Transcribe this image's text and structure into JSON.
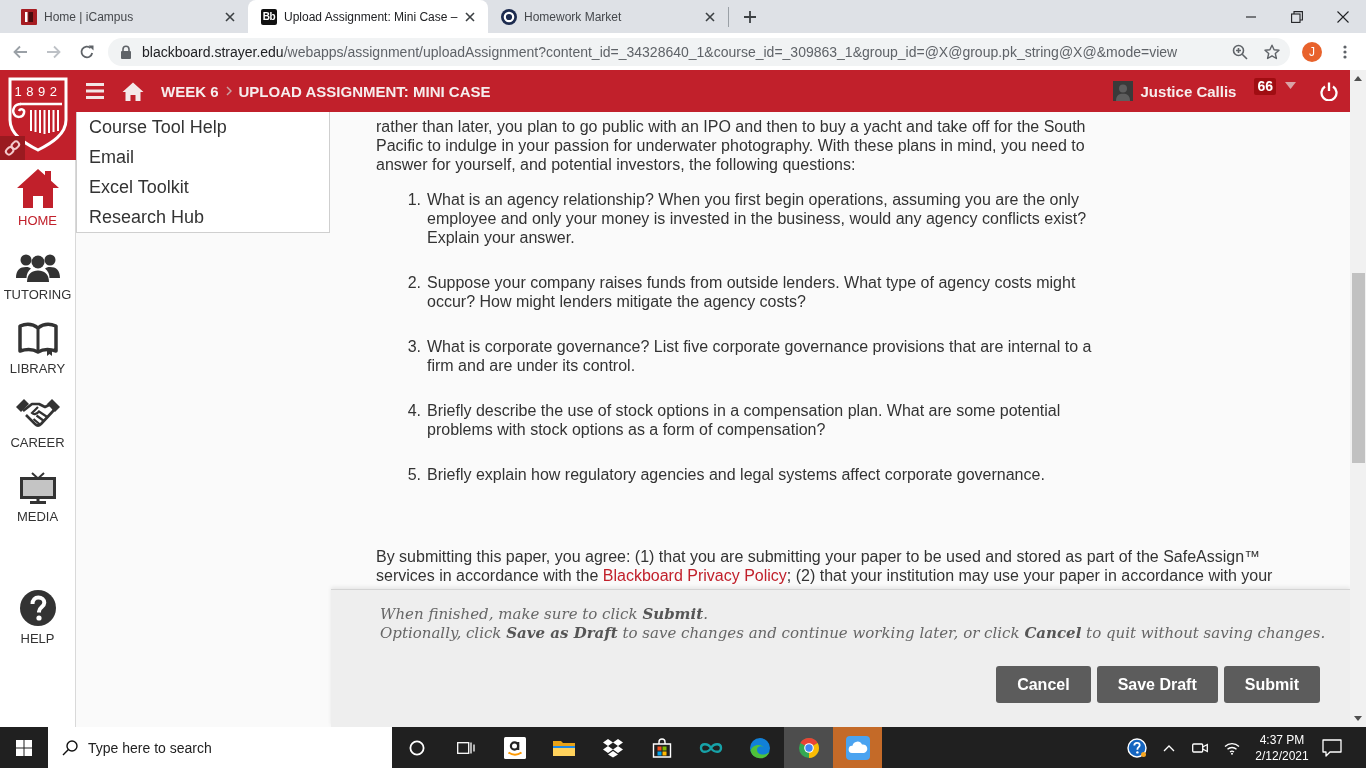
{
  "browser": {
    "tabs": [
      {
        "title": "Home | iCampus",
        "kind": "square",
        "selected": false
      },
      {
        "title": "Upload Assignment: Mini Case –",
        "kind": "label",
        "icon_text": "Bb",
        "selected": true
      },
      {
        "title": "Homework Market",
        "kind": "ring",
        "selected": false
      }
    ],
    "address_bar": {
      "host": "blackboard.strayer.edu",
      "path": "/webapps/assignment/uploadAssignment?content_id=_34328640_1&course_id=_309863_1&group_id=@X@group.pk_string@X@&mode=view"
    },
    "profile": {
      "initial": "J"
    }
  },
  "header": {
    "logo": {
      "year": "1892"
    },
    "breadcrumb": [
      "WEEK 6",
      "UPLOAD ASSIGNMENT: MINI CASE"
    ],
    "user": {
      "name": "Justice Callis",
      "badge": "66"
    }
  },
  "sidebar": {
    "items": [
      {
        "label": "HOME",
        "kind": "house",
        "selected": true
      },
      {
        "label": "TUTORING",
        "kind": "people",
        "selected": false
      },
      {
        "label": "LIBRARY",
        "kind": "book",
        "selected": false
      },
      {
        "label": "CAREER",
        "kind": "handshake",
        "selected": false
      },
      {
        "label": "MEDIA",
        "kind": "monitor",
        "selected": false
      }
    ],
    "help": {
      "label": "HELP"
    }
  },
  "course_menu": {
    "items": [
      "Course Tool Help",
      "Email",
      "Excel Toolkit",
      "Research Hub"
    ]
  },
  "content": {
    "intro": "rather than later, you plan to go public with an IPO and then to buy a yacht and take off for the South Pacific to indulge in your passion for underwater photography. With these plans in mind, you need to answer for yourself, and potential investors, the following questions:",
    "questions": [
      {
        "number": "1.",
        "text": "What is an agency relationship? When you first begin operations, assuming you are the only employee and only your money is invested in the business, would any agency conflicts exist? Explain your answer."
      },
      {
        "number": "2.",
        "text": "Suppose your company raises funds from outside lenders. What type of agency costs might occur? How might lenders mitigate the agency costs?"
      },
      {
        "number": "3.",
        "text": "What is corporate governance? List five corporate governance provisions that are internal to a firm and are under its control."
      },
      {
        "number": "4.",
        "text": "Briefly describe the use of stock options in a compensation plan. What are some potential problems with stock options as a form of compensation?"
      },
      {
        "number": "5.",
        "text": "Briefly explain how regulatory agencies and legal systems affect corporate governance."
      }
    ],
    "agreement": {
      "before": "By submitting this paper, you agree: (1) that you are submitting your paper to be used and stored as part of the SafeAssign™ services in accordance with the ",
      "link": "Blackboard Privacy Policy",
      "after": "; (2) that your institution may use your paper in accordance with your"
    }
  },
  "submit_bar": {
    "instructions": [
      "When finished, make sure to click **Submit**.",
      "Optionally, click **Save as Draft** to save changes and continue working later, or click **Cancel** to quit without saving changes."
    ],
    "buttons": [
      "Cancel",
      "Save Draft",
      "Submit"
    ]
  },
  "taskbar": {
    "search": {
      "placeholder": "Type here to search"
    },
    "apps": [
      {
        "kind": "cortana",
        "selected": false,
        "alert": false
      },
      {
        "kind": "task_view",
        "selected": false,
        "alert": false
      },
      {
        "kind": "amazon",
        "selected": false,
        "alert": false
      },
      {
        "kind": "explorer",
        "selected": false,
        "alert": false
      },
      {
        "kind": "dropbox",
        "selected": false,
        "alert": false
      },
      {
        "kind": "store",
        "selected": false,
        "alert": false
      },
      {
        "kind": "infinity",
        "selected": false,
        "alert": false
      },
      {
        "kind": "edge",
        "selected": false,
        "alert": false
      },
      {
        "kind": "chrome",
        "selected": true,
        "alert": false
      },
      {
        "kind": "icloud",
        "selected": false,
        "alert": true
      }
    ],
    "clock": {
      "time": "4:37 PM",
      "date": "2/12/2021"
    }
  }
}
